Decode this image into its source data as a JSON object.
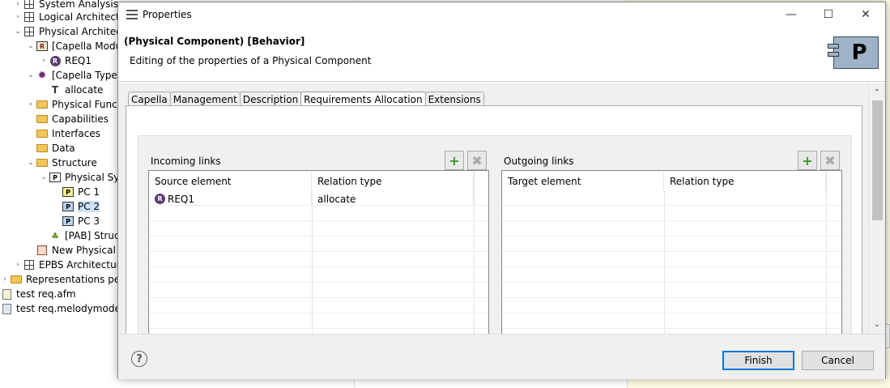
{
  "tree": {
    "items": [
      {
        "label": "System Analysis",
        "icon": "grid-icon"
      },
      {
        "label": "Logical Architectu",
        "icon": "grid-icon"
      },
      {
        "label": "Physical Architectu",
        "icon": "grid-icon"
      },
      {
        "label": "[Capella Module",
        "icon": "requirement-module-icon"
      },
      {
        "label": "REQ1",
        "icon": "requirement-icon"
      },
      {
        "label": "[Capella Types",
        "icon": "gear-icon"
      },
      {
        "label": "allocate",
        "icon": "type-icon"
      },
      {
        "label": "Physical Functi",
        "icon": "folder-icon"
      },
      {
        "label": "Capabilities",
        "icon": "folder-icon"
      },
      {
        "label": "Interfaces",
        "icon": "folder-icon"
      },
      {
        "label": "Data",
        "icon": "folder-icon"
      },
      {
        "label": "Structure",
        "icon": "folder-icon"
      },
      {
        "label": "Physical Syst",
        "icon": "physical-component-icon"
      },
      {
        "label": "PC 1",
        "icon": "physical-component-icon"
      },
      {
        "label": "PC 2",
        "icon": "physical-component-icon"
      },
      {
        "label": "PC 3",
        "icon": "physical-component-icon"
      },
      {
        "label": "[PAB] Struct",
        "icon": "diagram-icon"
      },
      {
        "label": "New Physical C",
        "icon": "table-icon"
      },
      {
        "label": "EPBS Architecture",
        "icon": "grid-icon"
      },
      {
        "label": "Representations per c",
        "icon": "folder-icon"
      },
      {
        "label": "test req.afm",
        "icon": "file-icon"
      },
      {
        "label": "test req.melodymodeller",
        "icon": "file-icon"
      }
    ]
  },
  "dialog": {
    "title": "Properties",
    "header_title": "(Physical Component) [Behavior]",
    "header_subtitle": "Editing of the properties of a Physical Component",
    "header_icon_letter": "P",
    "tabs": [
      "Capella",
      "Management",
      "Description",
      "Requirements Allocation",
      "Extensions"
    ],
    "active_tab": "Requirements Allocation",
    "incoming": {
      "label": "Incoming links",
      "columns": [
        "Source element",
        "Relation type"
      ],
      "rows": [
        {
          "element": "REQ1",
          "relation": "allocate"
        }
      ]
    },
    "outgoing": {
      "label": "Outgoing links",
      "columns": [
        "Target element",
        "Relation type"
      ],
      "rows": []
    },
    "add_symbol": "+",
    "remove_symbol": "✖",
    "help_symbol": "?",
    "finish_label": "Finish",
    "cancel_label": "Cancel"
  },
  "colors": {
    "selection": "#cce3f7",
    "default_button_border": "#0078d7",
    "add_green": "#3a9a2a"
  }
}
